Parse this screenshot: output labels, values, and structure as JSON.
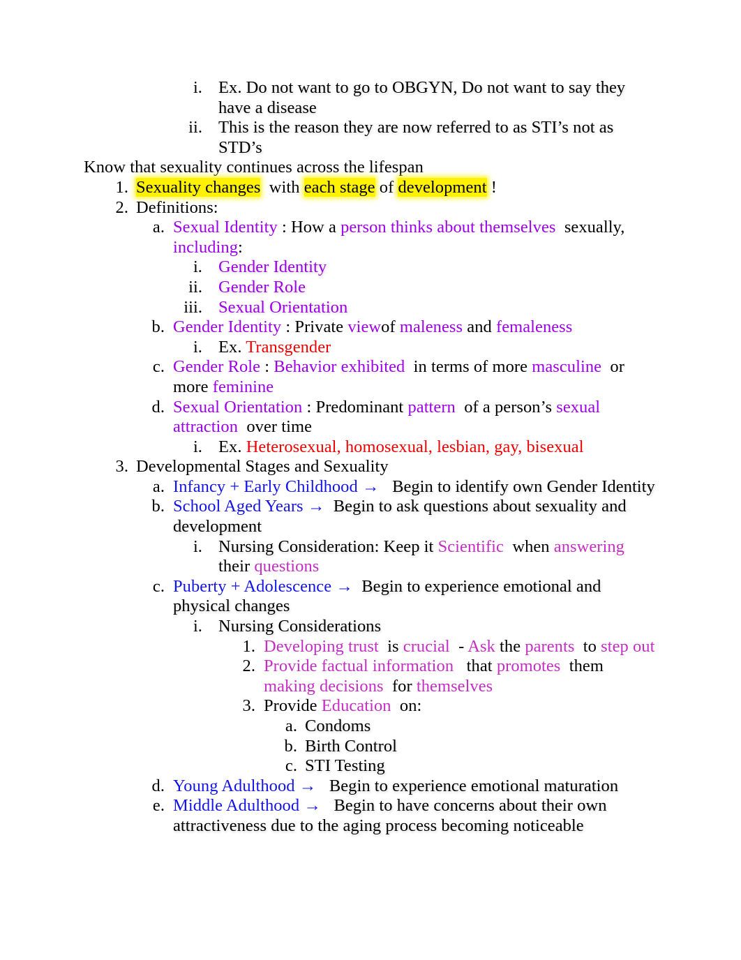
{
  "document": {
    "colors": {
      "black": "#000000",
      "purple": "#9D00E8",
      "magenta": "#C42EC4",
      "blue": "#1414E6",
      "red": "#F00000",
      "highlight_yellow": "#FFF200"
    }
  },
  "outline": {
    "top_i": {
      "marker": "i.",
      "text": "Ex. Do not want to go to OBGYN, Do not want to say they have a disease"
    },
    "top_ii": {
      "marker": "ii.",
      "text": "This is the reason they are now referred to as STI’s not as STD’s"
    },
    "heading": "Know that sexuality continues across the lifespan",
    "item1": {
      "marker": "1.",
      "seg_a": "Sexuality changes",
      "seg_b": "with",
      "seg_c": "each stage",
      "seg_d": "of",
      "seg_e": "development",
      "seg_f": "!"
    },
    "item2": {
      "marker": "2.",
      "text": "Definitions:"
    },
    "def_a": {
      "marker": "a.",
      "term": "Sexual Identity",
      "colon": ": How a",
      "phrase": "person thinks about themselves",
      "tail": "sexually,",
      "cont_purple": "including",
      "cont_tail": ":"
    },
    "def_a_i": {
      "marker": "i.",
      "text": "Gender Identity"
    },
    "def_a_ii": {
      "marker": "ii.",
      "text": "Gender Role"
    },
    "def_a_iii": {
      "marker": "iii.",
      "text": "Sexual Orientation"
    },
    "def_b": {
      "marker": "b.",
      "term": "Gender Identity",
      "colon": ": Private",
      "w1": "view",
      "w2": "of",
      "w3": "maleness",
      "w4": "and",
      "w5": "femaleness"
    },
    "def_b_i": {
      "marker": "i.",
      "prefix": "Ex.",
      "example": "Transgender"
    },
    "def_c": {
      "marker": "c.",
      "term": "Gender Role",
      "colon": ":",
      "w1": "Behavior exhibited",
      "w2": "in terms of more",
      "w3": "masculine",
      "w4": "or more",
      "w5": "feminine"
    },
    "def_d": {
      "marker": "d.",
      "term": "Sexual Orientation",
      "colon": ": Predominant",
      "w1": "pattern",
      "w2": "of a person’s",
      "w3": "sexual attraction",
      "w4": "over time"
    },
    "def_d_i": {
      "marker": "i.",
      "prefix": "Ex.",
      "example": "Heterosexual, homosexual, lesbian, gay, bisexual"
    },
    "item3": {
      "marker": "3.",
      "text": "Developmental Stages and Sexuality"
    },
    "stage_a": {
      "marker": "a.",
      "stage": "Infancy + Early Childhood",
      "arrow": "→",
      "text": "Begin to identify own Gender Identity"
    },
    "stage_b": {
      "marker": "b.",
      "stage": "School Aged Years",
      "arrow": "→",
      "text": "Begin to ask questions  about sexuality and development"
    },
    "stage_b_i": {
      "marker": "i.",
      "lead": "Nursing Consideration:   Keep it",
      "w1": "Scientific",
      "w2": "when",
      "w3": "answering",
      "w4": "their",
      "w5": "questions"
    },
    "stage_c": {
      "marker": "c.",
      "stage": "Puberty + Adolescence",
      "arrow": "→",
      "text": "Begin to experience emotional  and physical changes"
    },
    "stage_c_i": {
      "marker": "i.",
      "text": "Nursing Considerations"
    },
    "cons_1": {
      "marker": "1.",
      "w1": "Developing trust",
      "w2": "is",
      "w3": "crucial",
      "w4": "-",
      "w5": "Ask",
      "w6": "the",
      "w7": "parents",
      "w8": "to",
      "w9": "step out"
    },
    "cons_2": {
      "marker": "2.",
      "w1": "Provide factual information",
      "w2": "that",
      "w3": "promotes",
      "w4": "them",
      "w5": "making decisions",
      "w6": "for",
      "w7": "themselves"
    },
    "cons_3": {
      "marker": "3.",
      "w1": "Provide",
      "w2": "Education",
      "w3": "on:"
    },
    "cons_3_a": {
      "marker": "a.",
      "text": "Condoms"
    },
    "cons_3_b": {
      "marker": "b.",
      "text": "Birth Control"
    },
    "cons_3_c": {
      "marker": "c.",
      "text": "STI Testing"
    },
    "stage_d": {
      "marker": "d.",
      "stage": "Young Adulthood",
      "arrow": "→",
      "text": "Begin to experience emotional maturation"
    },
    "stage_e": {
      "marker": "e.",
      "stage": "Middle Adulthood",
      "arrow": "→",
      "text": "Begin to have concerns  about their own attractiveness due  to the aging process  becoming noticeable"
    }
  }
}
